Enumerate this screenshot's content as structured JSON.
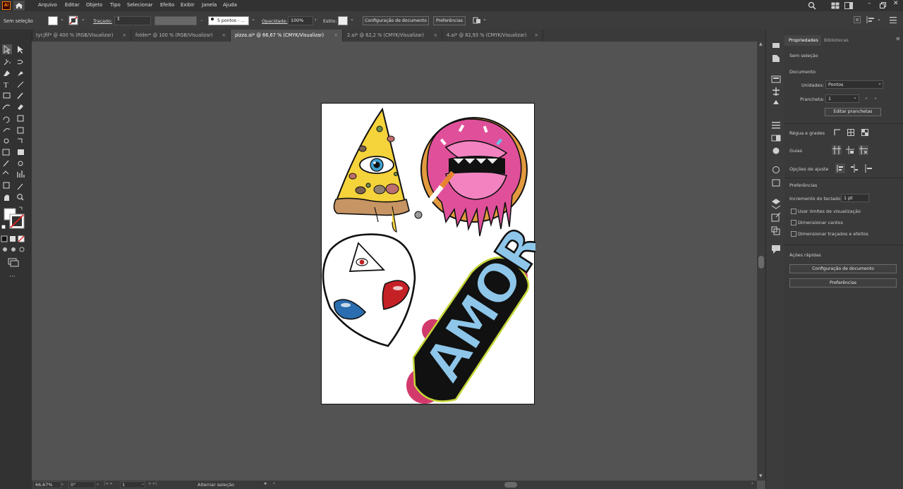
{
  "app": {
    "logo": "Ai",
    "home_icon": "home-icon"
  },
  "menu": [
    "Arquivo",
    "Editar",
    "Objeto",
    "Tipo",
    "Selecionar",
    "Efeito",
    "Exibir",
    "Janela",
    "Ajuda"
  ],
  "control_bar": {
    "selection_label": "Sem seleção",
    "stroke_label": "Traçado:",
    "brush_value": "5 pontos - ...",
    "opacity_label": "Opacidade:",
    "opacity_value": "100%",
    "style_label": "Estilo:",
    "doc_setup_button": "Configuração de documento",
    "preferences_button": "Preferências"
  },
  "tabs": [
    {
      "label": "tyr.jfif* @ 400 % (RGB/Visualizar)",
      "active": false
    },
    {
      "label": "folder* @ 100 % (RGB/Visualizar)",
      "active": false
    },
    {
      "label": "pizza.ai* @ 66,67 % (CMYK/Visualizar)",
      "active": true
    },
    {
      "label": "2.ai* @ 62,2 % (CMYK/Visualizar)",
      "active": false
    },
    {
      "label": "4.ai* @ 82,93 % (CMYK/Visualizar)",
      "active": false
    }
  ],
  "status_bar": {
    "zoom": "66,67%",
    "rotation": "0°",
    "artboard": "1",
    "status_text": "Alternar seleção"
  },
  "panel": {
    "tab_properties": "Propriedades",
    "tab_libraries": "Bibliotecas",
    "no_selection": "Sem seleção",
    "document_heading": "Documento",
    "units_label": "Unidades:",
    "units_value": "Pontos",
    "artboard_label": "Prancheta:",
    "artboard_value": "1",
    "edit_artboards_button": "Editar pranchetas",
    "rulers_grids_label": "Régua e grades",
    "guides_label": "Guias",
    "snap_options_label": "Opções de ajuste",
    "preferences_heading": "Preferências",
    "keyboard_increment_label": "Incremento do teclado:",
    "keyboard_increment_value": "1 pt",
    "checkbox_preview_bounds": "Usar limites de visualização",
    "checkbox_scale_corners": "Dimensionar cantos",
    "checkbox_scale_strokes": "Dimensionar traçados e efeitos",
    "quick_actions_heading": "Ações rápidas",
    "quick_doc_setup_button": "Configuração de documento",
    "quick_preferences_button": "Preferências"
  },
  "artwork": {
    "amor_text": "AMOR"
  },
  "colors": {
    "accent_logo": "#ff7c00",
    "canvas": "#535353",
    "panel": "#3a3a3a",
    "pizza": "#f5d33b",
    "donut_icing": "#e0509a",
    "amor_fill": "#8ec6ea"
  }
}
